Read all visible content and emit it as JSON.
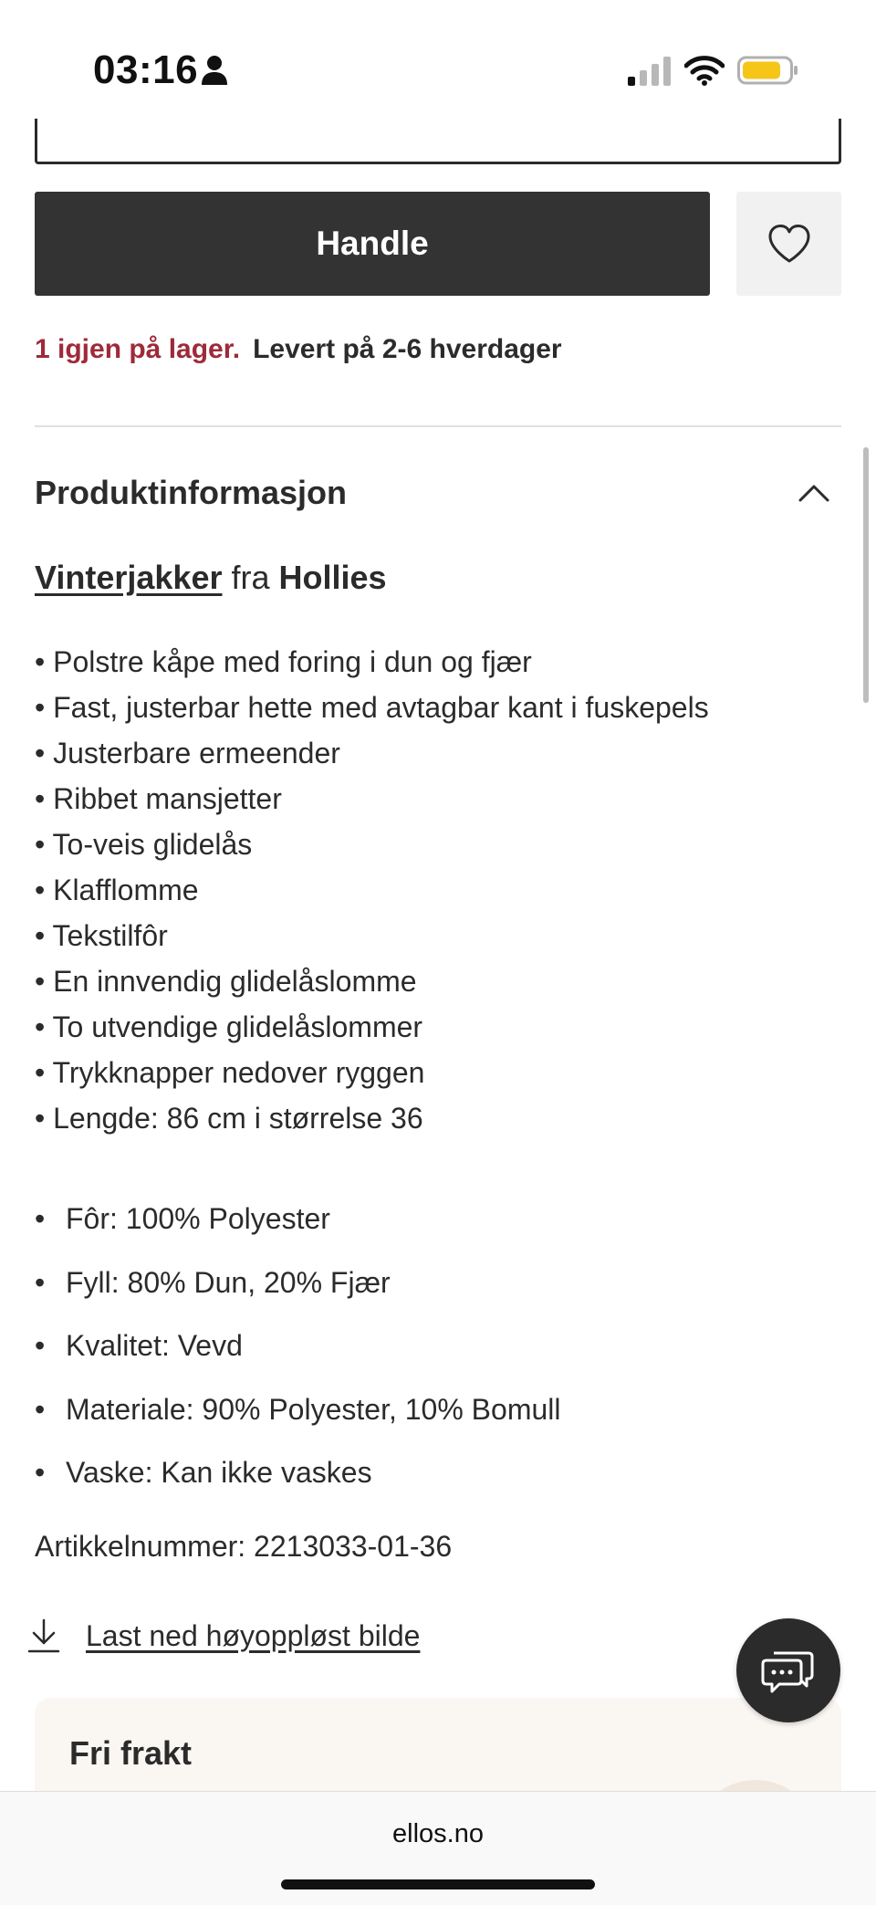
{
  "status_bar": {
    "time": "03:16",
    "icons": [
      "person-icon",
      "signal-icon",
      "wifi-icon",
      "battery-icon"
    ],
    "battery_color": "#f5c518"
  },
  "product": {
    "buy_label": "Handle",
    "favorite_icon": "heart-icon",
    "stock_text": "1 igjen på lager.",
    "delivery_text": "Levert på 2-6 hverdager",
    "stock_color": "#9e2a3a"
  },
  "product_info": {
    "title": "Produktinformasjon",
    "toggle_icon": "chevron-up-icon",
    "category_link": "Vinterjakker",
    "from_text": "fra",
    "brand": "Hollies",
    "features": [
      "• Polstre kåpe med foring i dun og fjær",
      "• Fast, justerbar hette med avtagbar kant i fuskepels",
      "• Justerbare ermeender",
      "• Ribbet mansjetter",
      "• To-veis glidelås",
      "• Klafflomme",
      "• Tekstilfôr",
      "• En innvendig glidelåslomme",
      "• To utvendige glidelåslommer",
      "• Trykknapper nedover ryggen",
      "• Lengde: 86 cm i størrelse 36"
    ],
    "specs": [
      "Fôr: 100% Polyester",
      "Fyll: 80% Dun, 20% Fjær",
      "Kvalitet: Vevd",
      "Materiale: 90% Polyester, 10% Bomull",
      "Vaske: Kan ikke vaskes"
    ],
    "article_number": "Artikkelnummer: 2213033-01-36",
    "download_label": "Last ned høyoppløst bilde"
  },
  "promo": {
    "title": "Fri frakt"
  },
  "chat": {
    "icon": "chat-icon"
  },
  "browser": {
    "url": "ellos.no"
  }
}
